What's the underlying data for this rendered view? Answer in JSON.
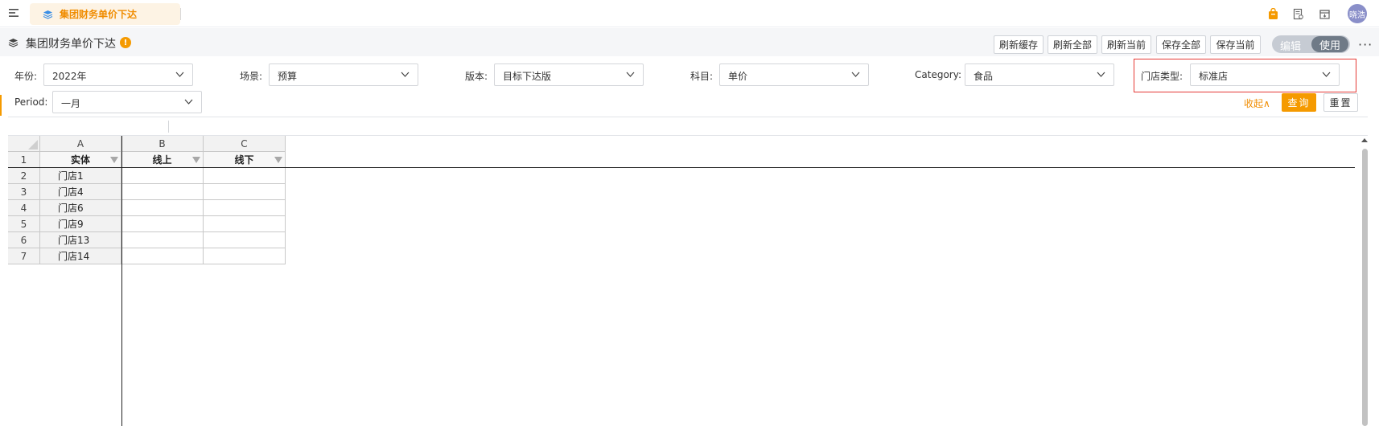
{
  "topbar": {
    "active_tab": "集团财务单价下达",
    "avatar_text": "晓浩",
    "icons": [
      "menu-icon",
      "bag-icon",
      "doc-icon",
      "archive-icon"
    ]
  },
  "page": {
    "title": "集团财务单价下达",
    "info_badge": "!"
  },
  "actions": {
    "refresh_cache": "刷新缓存",
    "refresh_all": "刷新全部",
    "refresh_current": "刷新当前",
    "save_all": "保存全部",
    "save_current": "保存当前",
    "mode_edit": "编辑",
    "mode_use": "使用",
    "more": "···"
  },
  "filters": {
    "year": {
      "label": "年份:",
      "value": "2022年"
    },
    "scenario": {
      "label": "场景:",
      "value": "预算"
    },
    "version": {
      "label": "版本:",
      "value": "目标下达版"
    },
    "subject": {
      "label": "科目:",
      "value": "单价"
    },
    "category": {
      "label": "Category:",
      "value": "食品"
    },
    "store_type": {
      "label": "门店类型:",
      "value": "标准店"
    },
    "period": {
      "label": "Period:",
      "value": "一月"
    },
    "collapse": "收起∧",
    "query": "查询",
    "reset": "重置"
  },
  "sheet": {
    "columns": [
      "A",
      "B",
      "C"
    ],
    "row_numbers": [
      "1",
      "2",
      "3",
      "4",
      "5",
      "6",
      "7"
    ],
    "header_row": [
      "实体",
      "线上",
      "线下"
    ],
    "rows": [
      {
        "entity": "门店1",
        "online": "",
        "offline": ""
      },
      {
        "entity": "门店4",
        "online": "",
        "offline": ""
      },
      {
        "entity": "门店6",
        "online": "",
        "offline": ""
      },
      {
        "entity": "门店9",
        "online": "",
        "offline": ""
      },
      {
        "entity": "门店13",
        "online": "",
        "offline": ""
      },
      {
        "entity": "门店14",
        "online": "",
        "offline": ""
      }
    ]
  },
  "colors": {
    "accent": "#f59a00",
    "highlight_border": "#e53935",
    "mode_active": "#6f7a87"
  }
}
